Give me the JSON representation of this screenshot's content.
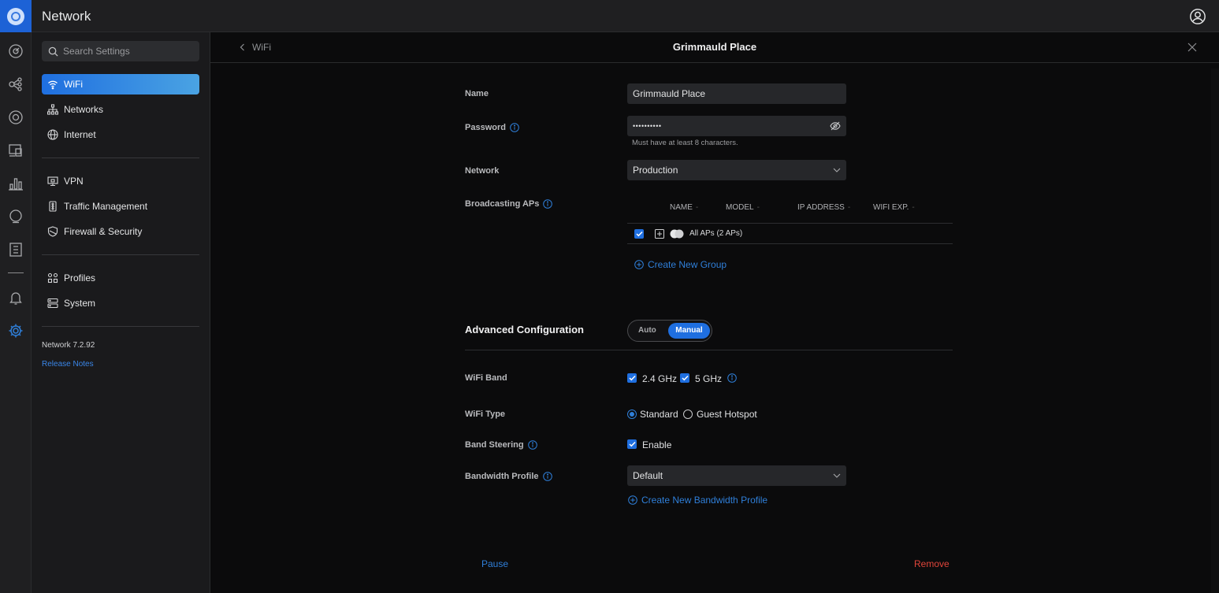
{
  "app": {
    "title": "Network"
  },
  "rail": {
    "icons": [
      "dashboard-icon",
      "topology-icon",
      "devices-icon",
      "client-devices-icon",
      "statistics-icon",
      "insights-icon",
      "logs-icon",
      "alerts-icon",
      "settings-icon"
    ]
  },
  "sidebar": {
    "search_placeholder": "Search Settings",
    "groups": [
      {
        "items": [
          {
            "label": "WiFi",
            "icon": "wifi-icon",
            "active": true
          },
          {
            "label": "Networks",
            "icon": "networks-icon"
          },
          {
            "label": "Internet",
            "icon": "globe-icon"
          }
        ]
      },
      {
        "items": [
          {
            "label": "VPN",
            "icon": "vpn-icon"
          },
          {
            "label": "Traffic Management",
            "icon": "traffic-icon"
          },
          {
            "label": "Firewall & Security",
            "icon": "shield-icon"
          }
        ]
      },
      {
        "items": [
          {
            "label": "Profiles",
            "icon": "profiles-icon"
          },
          {
            "label": "System",
            "icon": "system-icon"
          }
        ]
      }
    ],
    "version": "Network 7.2.92",
    "release_notes": "Release Notes"
  },
  "panel": {
    "back_label": "WiFi",
    "title": "Grimmauld Place",
    "name_label": "Name",
    "name_value": "Grimmauld Place",
    "password_label": "Password",
    "password_value": "••••••••••",
    "password_help": "Must have at least 8 characters.",
    "network_label": "Network",
    "network_value": "Production",
    "broadcasting_label": "Broadcasting APs",
    "ap_table": {
      "columns": [
        "NAME",
        "MODEL",
        "IP ADDRESS",
        "WIFI EXP."
      ],
      "row_label": "All APs (2 APs)"
    },
    "create_group": "Create New Group",
    "advanced_title": "Advanced Configuration",
    "mode_auto": "Auto",
    "mode_manual": "Manual",
    "band_label": "WiFi Band",
    "band_24": "2.4 GHz",
    "band_5": "5 GHz",
    "type_label": "WiFi Type",
    "type_standard": "Standard",
    "type_guest": "Guest Hotspot",
    "steering_label": "Band Steering",
    "steering_enable": "Enable",
    "bandwidth_label": "Bandwidth Profile",
    "bandwidth_value": "Default",
    "create_bandwidth": "Create New Bandwidth Profile",
    "pause": "Pause",
    "remove": "Remove"
  },
  "colors": {
    "accent": "#1f6fe0",
    "danger": "#e0453a"
  }
}
